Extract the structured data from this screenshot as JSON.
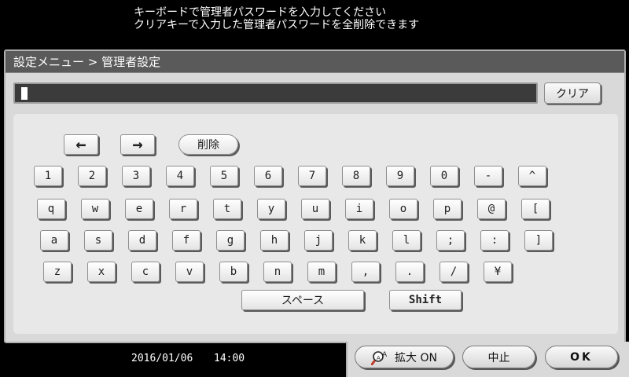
{
  "message": {
    "line1": "キーボードで管理者パスワードを入力してください",
    "line2": "クリアキーで入力した管理者パスワードを全削除できます"
  },
  "breadcrumb": "設定メニュー > 管理者設定",
  "input": {
    "value": ""
  },
  "clear_label": "クリア",
  "keyboard": {
    "left_arrow": "←",
    "right_arrow": "→",
    "delete_label": "削除",
    "row1": [
      "1",
      "2",
      "3",
      "4",
      "5",
      "6",
      "7",
      "8",
      "9",
      "0",
      "-",
      "^"
    ],
    "row2": [
      "q",
      "w",
      "e",
      "r",
      "t",
      "y",
      "u",
      "i",
      "o",
      "p",
      "@",
      "["
    ],
    "row3": [
      "a",
      "s",
      "d",
      "f",
      "g",
      "h",
      "j",
      "k",
      "l",
      ";",
      ":",
      "]"
    ],
    "row4": [
      "z",
      "x",
      "c",
      "v",
      "b",
      "n",
      "m",
      ",",
      ".",
      "/",
      "¥"
    ],
    "space_label": "スペース",
    "shift_label": "Shift"
  },
  "status": {
    "date": "2016/01/06",
    "time": "14:00"
  },
  "footer": {
    "zoom_label": "拡大 ON",
    "stop_label": "中止",
    "ok_label": "OK"
  },
  "icons": {
    "zoom": "magnifier-icon"
  }
}
